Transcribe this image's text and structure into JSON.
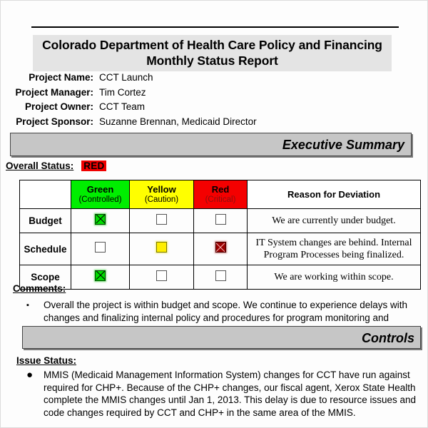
{
  "document": {
    "title_line1": "Colorado Department of Health Care Policy and Financing",
    "title_line2": "Monthly Status Report"
  },
  "project": {
    "fields": [
      {
        "label": "Project Name:",
        "value": "CCT Launch"
      },
      {
        "label": "Project Manager:",
        "value": "Tim Cortez"
      },
      {
        "label": "Project Owner:",
        "value": "CCT Team"
      },
      {
        "label": "Project Sponsor:",
        "value": "Suzanne Brennan, Medicaid Director"
      }
    ]
  },
  "sections": {
    "executive_summary": "Executive Summary",
    "controls": "Controls"
  },
  "overall_status": {
    "label": "Overall Status:",
    "value": "RED",
    "value_color": "#f00000"
  },
  "status_table": {
    "headers": {
      "blank": "",
      "green": {
        "title": "Green",
        "sub": "(Controlled)",
        "color": "#00ee00"
      },
      "yellow": {
        "title": "Yellow",
        "sub": "(Caution)",
        "color": "#ffff00"
      },
      "red": {
        "title": "Red",
        "sub": "(Critical)",
        "color": "#f40000"
      },
      "reason": "Reason for Deviation"
    },
    "rows": [
      {
        "name": "Budget",
        "green": "checked-green",
        "yellow": "empty",
        "red": "empty",
        "reason": "We are currently under budget."
      },
      {
        "name": "Schedule",
        "green": "empty",
        "yellow": "filled-yellow",
        "red": "checked-red",
        "reason": "IT System changes are behind. Internal Program Processes being finalized."
      },
      {
        "name": "Scope",
        "green": "checked-green",
        "yellow": "empty",
        "red": "empty",
        "reason": "We are working within scope."
      }
    ]
  },
  "comments": {
    "heading": "Comments:",
    "bullet": "▪",
    "text": "Overall the project is within budget and scope.  We continue to experience delays with changes and finalizing internal policy and procedures for program monitoring and compliance"
  },
  "issue_status": {
    "heading": "Issue Status:",
    "bullet": "●",
    "text": "MMIS (Medicaid Management Information System) changes for CCT have run against required for CHP+. Because of the CHP+ changes, our fiscal agent, Xerox State Health complete the MMIS changes until Jan 1, 2013.  This delay is due to resource issues and code changes required by CCT and CHP+ in the same area of the MMIS."
  }
}
